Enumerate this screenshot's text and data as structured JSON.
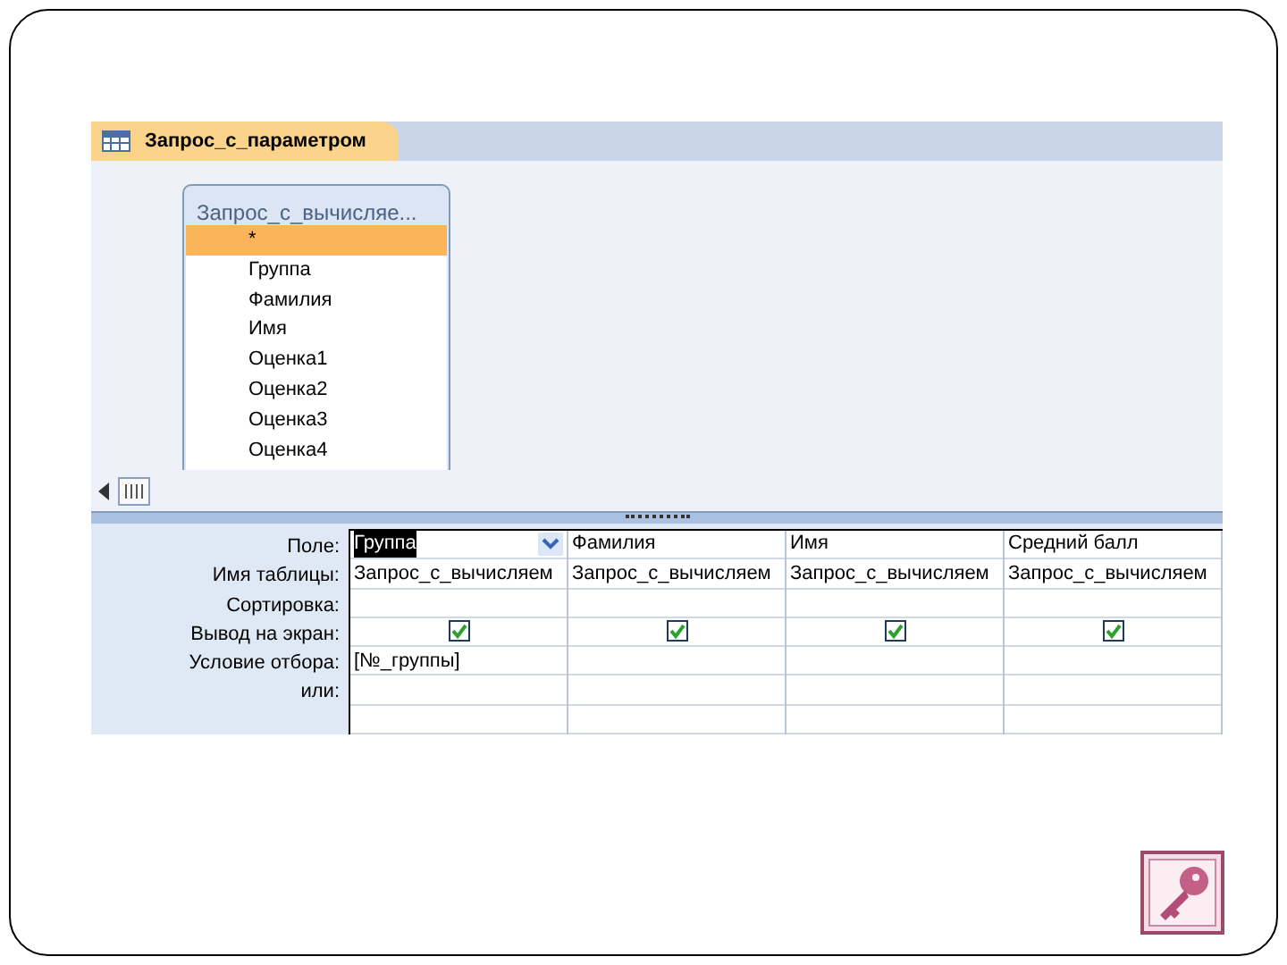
{
  "document_tab": {
    "title": "Запрос_с_параметром",
    "selected": true
  },
  "field_list": {
    "title": "Запрос_с_вычисляе...",
    "fields": [
      {
        "name": "*",
        "selected": true
      },
      {
        "name": "Группа",
        "selected": false
      },
      {
        "name": "Фамилия",
        "selected": false
      },
      {
        "name": "Имя",
        "selected": false
      },
      {
        "name": "Оценка1",
        "selected": false
      },
      {
        "name": "Оценка2",
        "selected": false
      },
      {
        "name": "Оценка3",
        "selected": false
      },
      {
        "name": "Оценка4",
        "selected": false
      }
    ]
  },
  "design_grid": {
    "row_labels": [
      "Поле:",
      "Имя таблицы:",
      "Сортировка:",
      "Вывод на экран:",
      "Условие отбора:",
      "или:"
    ],
    "columns": [
      {
        "field": "Группа",
        "selected": true,
        "table": "Запрос_с_вычисляем",
        "show": true,
        "criteria": "[№_группы]"
      },
      {
        "field": "Фамилия",
        "selected": false,
        "table": "Запрос_с_вычисляем",
        "show": true
      },
      {
        "field": "Имя",
        "selected": false,
        "table": "Запрос_с_вычисляем",
        "show": true
      },
      {
        "field": "Средний балл",
        "selected": false,
        "table": "Запрос_с_вычисляем",
        "show": true
      }
    ]
  }
}
